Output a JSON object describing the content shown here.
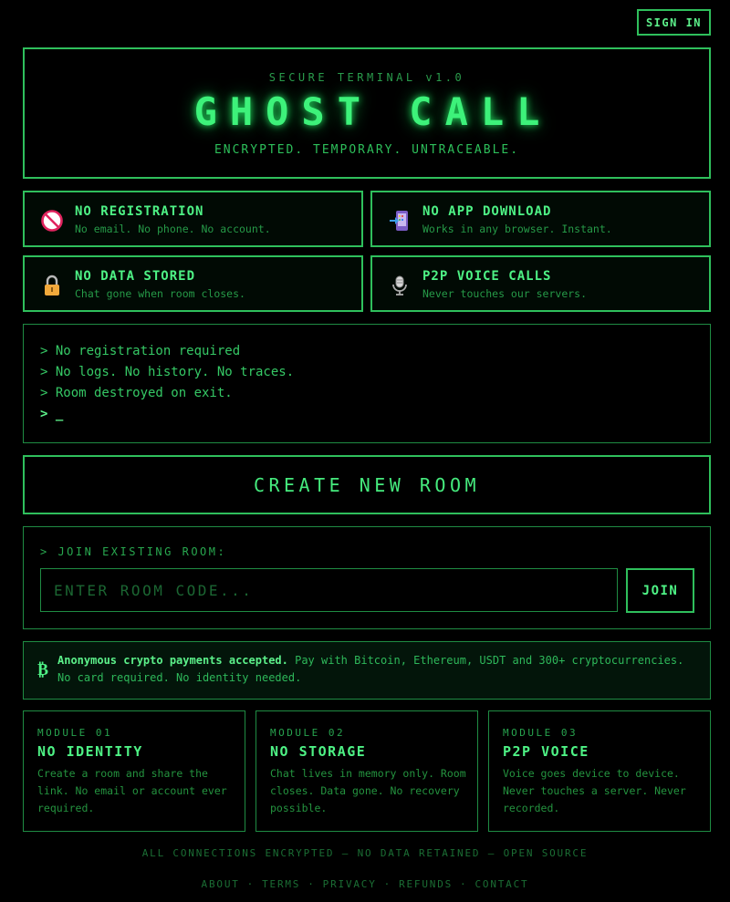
{
  "header": {
    "signin_label": "SIGN IN"
  },
  "hero": {
    "kicker": "SECURE TERMINAL v1.0",
    "title": "GHOST CALL",
    "subtitle": "ENCRYPTED. TEMPORARY. UNTRACEABLE."
  },
  "features": [
    {
      "icon": "no-entry-icon",
      "title": "NO REGISTRATION",
      "desc": "No email. No phone. No account."
    },
    {
      "icon": "phone-arrow-icon",
      "title": "NO APP DOWNLOAD",
      "desc": "Works in any browser. Instant."
    },
    {
      "icon": "lock-icon",
      "title": "NO DATA STORED",
      "desc": "Chat gone when room closes."
    },
    {
      "icon": "microphone-icon",
      "title": "P2P VOICE CALLS",
      "desc": "Never touches our servers."
    }
  ],
  "terminal": {
    "lines": [
      "> No registration required",
      "> No logs. No history. No traces.",
      "> Room destroyed on exit."
    ],
    "prompt": "> _"
  },
  "create_room_label": "CREATE NEW ROOM",
  "join": {
    "label": "> JOIN EXISTING ROOM:",
    "placeholder": "ENTER ROOM CODE...",
    "button_label": "JOIN"
  },
  "crypto": {
    "symbol": "₿",
    "bold": "Anonymous crypto payments accepted.",
    "text": " Pay with Bitcoin, Ethereum, USDT and 300+ cryptocurrencies. No card required. No identity needed."
  },
  "modules": [
    {
      "num": "MODULE 01",
      "title": "NO IDENTITY",
      "desc": "Create a room and share the link. No email or account ever required."
    },
    {
      "num": "MODULE 02",
      "title": "NO STORAGE",
      "desc": "Chat lives in memory only. Room closes. Data gone. No recovery possible."
    },
    {
      "num": "MODULE 03",
      "title": "P2P VOICE",
      "desc": "Voice goes device to device. Never touches a server. Never recorded."
    }
  ],
  "footer": {
    "note": "ALL CONNECTIONS ENCRYPTED — NO DATA RETAINED — OPEN SOURCE",
    "links": [
      "ABOUT",
      "TERMS",
      "PRIVACY",
      "REFUNDS",
      "CONTACT"
    ],
    "separator": "·"
  },
  "colors": {
    "accent": "#39d96a",
    "glow": "#3df27a",
    "background": "#000000",
    "border": "#2fbf5c"
  }
}
